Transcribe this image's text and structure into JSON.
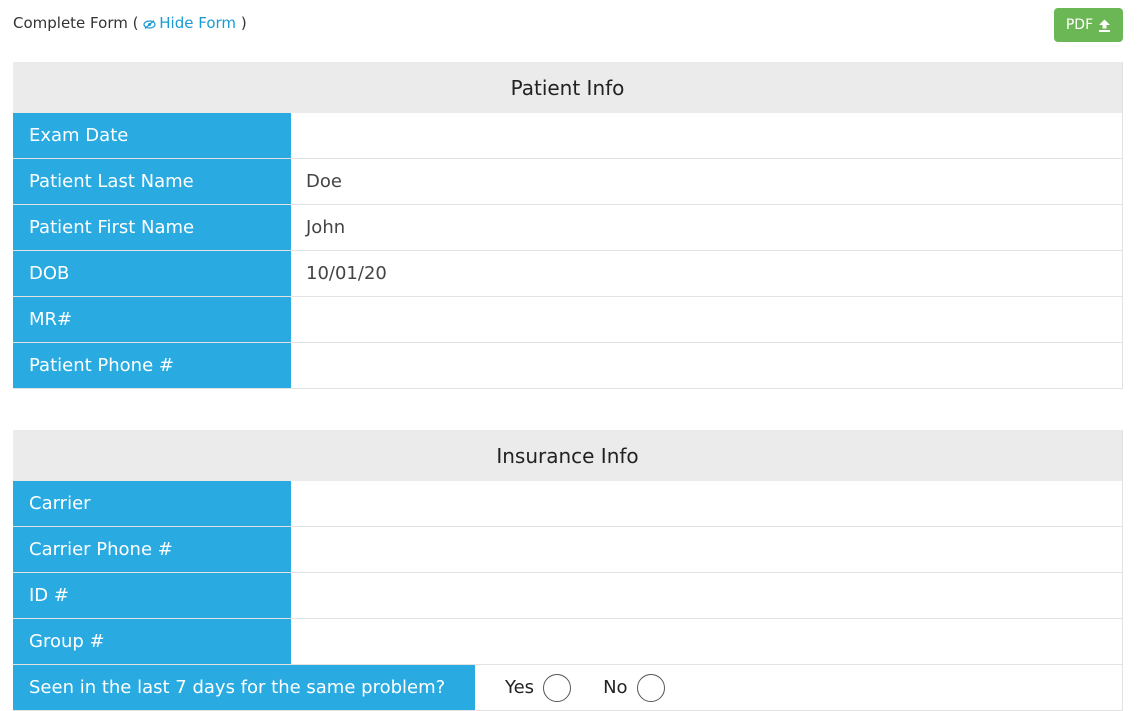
{
  "header": {
    "title": "Complete Form",
    "paren_open": "(",
    "hide_link": "Hide Form",
    "paren_close": ")",
    "pdf_button": "PDF"
  },
  "patient_info": {
    "title": "Patient Info",
    "rows": [
      {
        "label": "Exam Date",
        "value": ""
      },
      {
        "label": "Patient Last Name",
        "value": "Doe"
      },
      {
        "label": "Patient First Name",
        "value": "John"
      },
      {
        "label": "DOB",
        "value": "10/01/20"
      },
      {
        "label": "MR#",
        "value": ""
      },
      {
        "label": "Patient Phone #",
        "value": ""
      }
    ]
  },
  "insurance_info": {
    "title": "Insurance Info",
    "rows": [
      {
        "label": "Carrier",
        "value": ""
      },
      {
        "label": "Carrier Phone #",
        "value": ""
      },
      {
        "label": "ID #",
        "value": ""
      },
      {
        "label": "Group #",
        "value": ""
      }
    ],
    "seen_question": {
      "label": "Seen in the last 7 days for the same problem?",
      "yes": "Yes",
      "no": "No",
      "selected": ""
    }
  },
  "colors": {
    "label_bg": "#29abe2",
    "pdf_button_bg": "#6cb755",
    "link": "#1b9ad6",
    "section_header_bg": "#ebebeb"
  }
}
